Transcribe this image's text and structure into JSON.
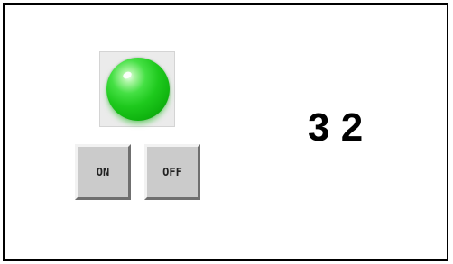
{
  "indicator": {
    "state": "on",
    "color": "#1ec91d"
  },
  "buttons": {
    "on_label": "ON",
    "off_label": "OFF"
  },
  "display": {
    "value": "3 2"
  }
}
